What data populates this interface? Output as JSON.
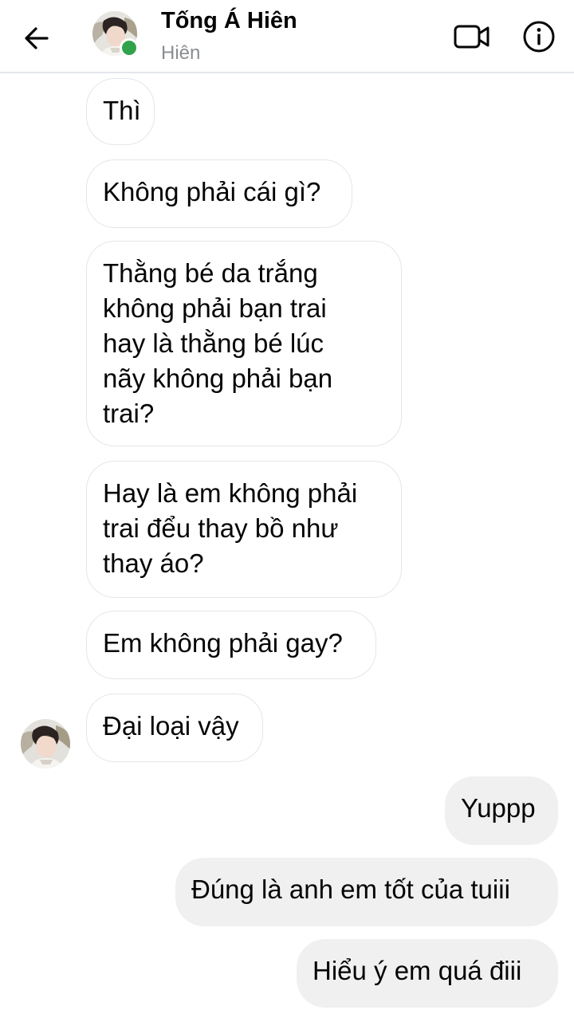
{
  "header": {
    "name": "Tống Á Hiên",
    "subtitle": "Hiên",
    "back_icon": "arrow-left-icon",
    "video_icon": "video-camera-icon",
    "info_icon": "info-circle-icon",
    "online_status_color": "#31a24c"
  },
  "messages": [
    {
      "sender": "contact",
      "text": "Thì"
    },
    {
      "sender": "contact",
      "text": "Không phải cái gì?"
    },
    {
      "sender": "contact",
      "text": "Thằng bé da trắng\nkhông phải bạn trai\nhay là thằng bé lúc\nnãy không phải bạn\ntrai?"
    },
    {
      "sender": "contact",
      "text": "Hay là em không phải\ntrai đểu thay bồ như\nthay áo?"
    },
    {
      "sender": "contact",
      "text": "Em không phải gay?"
    },
    {
      "sender": "contact",
      "text": "Đại loại vậy"
    },
    {
      "sender": "me",
      "text": "Yuppp"
    },
    {
      "sender": "me",
      "text": "Đúng là anh em tốt của tuiii"
    },
    {
      "sender": "me",
      "text": "Hiểu ý em quá điii"
    }
  ],
  "colors": {
    "incoming_bubble_border": "#e4e6eb",
    "outgoing_bubble_bg": "#f0f0f0",
    "text": "#050505",
    "secondary_text": "#8a8d91"
  }
}
